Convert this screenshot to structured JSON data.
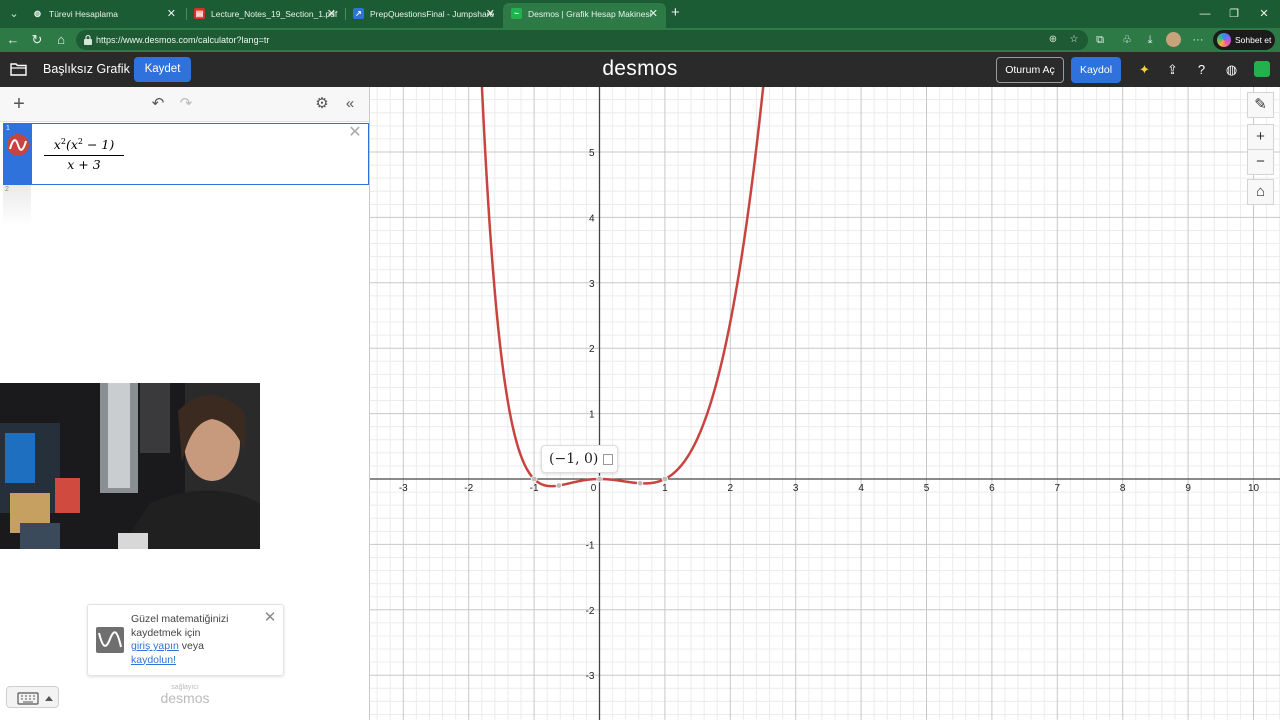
{
  "browser": {
    "tabs": [
      {
        "title": "Türevi Hesaplama",
        "icon": "globe-icon",
        "active": false
      },
      {
        "title": "Lecture_Notes_19_Section_1.pdf",
        "icon": "pdf-icon",
        "active": false
      },
      {
        "title": "PrepQuestionsFinal - Jumpshare",
        "icon": "jumpshare-icon",
        "active": false
      },
      {
        "title": "Desmos | Grafik Hesap Makinesi",
        "icon": "desmos-icon",
        "active": true
      }
    ],
    "url": "https://www.desmos.com/calculator?lang=tr",
    "copilot_label": "Sohbet et",
    "colors": {
      "tabbar": "#1c5c34",
      "toolbar": "#2d7a47"
    }
  },
  "desmos": {
    "graph_title": "Başlıksız Grafik",
    "save_label": "Kaydet",
    "brand": "desmos",
    "login_label": "Oturum Aç",
    "signup_label": "Kaydol",
    "accent_color": "#2f72dc",
    "curve_color": "#c74440"
  },
  "expressions": [
    {
      "index": "1",
      "numerator": {
        "base1": "x",
        "exp1": "2",
        "base2": "(x",
        "exp2": "2",
        "rest": " − 1)"
      },
      "denominator": "x + 3"
    },
    {
      "index": "2"
    }
  ],
  "graph": {
    "x_ticks": [
      "-3",
      "-2",
      "-1",
      "0",
      "1",
      "2",
      "3",
      "4",
      "5",
      "6",
      "7",
      "8",
      "9",
      "10"
    ],
    "y_ticks": [
      "5",
      "4",
      "3",
      "2",
      "1",
      "-1",
      "-2",
      "-3"
    ],
    "point_label": "(−1, 0)",
    "zoom_in": "+",
    "zoom_out": "−"
  },
  "promo": {
    "line1": "Güzel matematiğinizi kaydetmek için",
    "login_link": "giriş yapın",
    "or": "veya",
    "signup_link": "kaydolun!"
  },
  "footer": {
    "powered_small": "sağlayıcı",
    "powered_brand": "desmos"
  }
}
